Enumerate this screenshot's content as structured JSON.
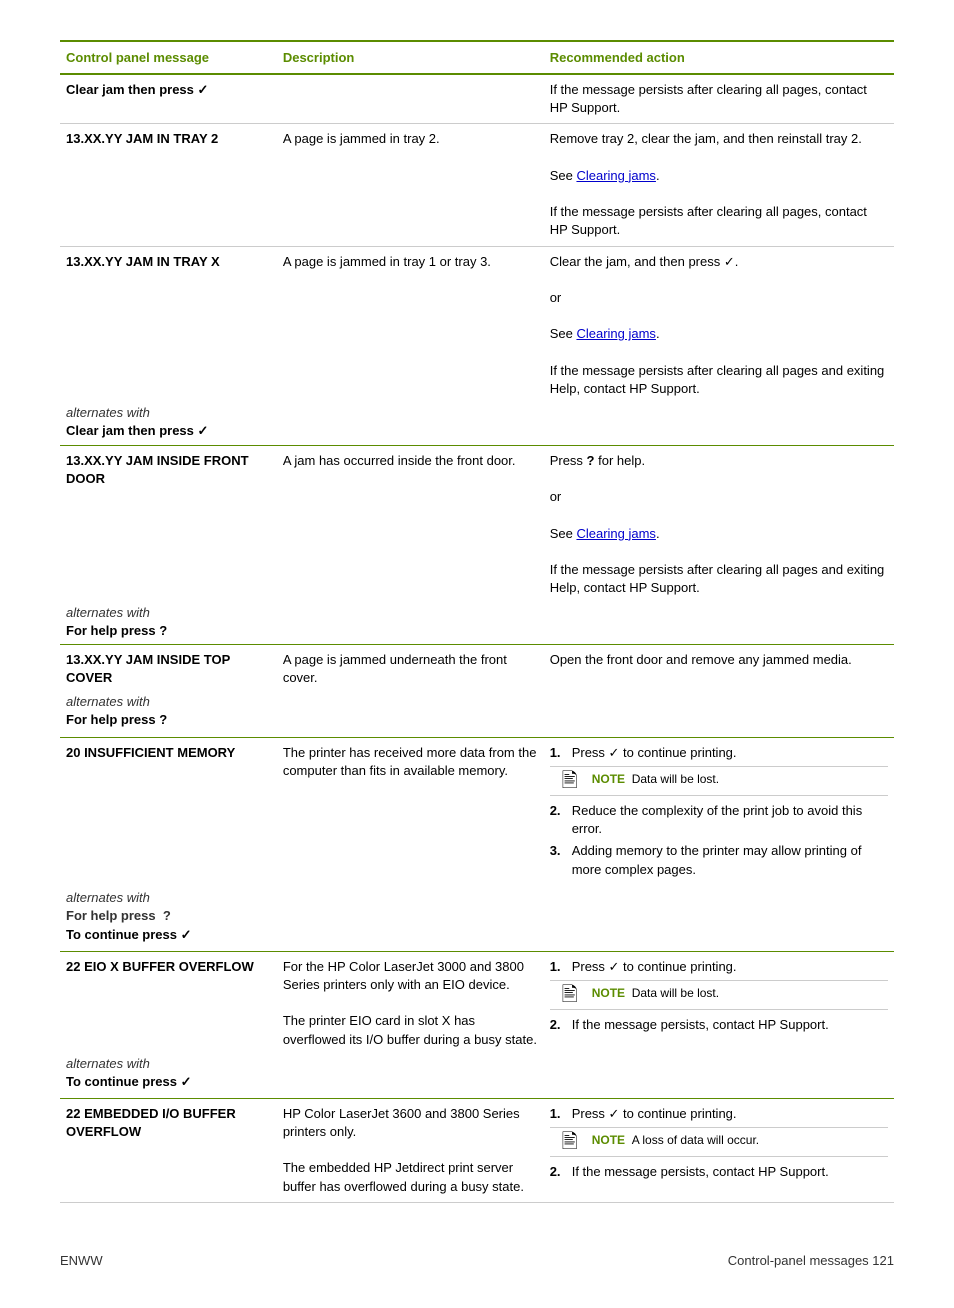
{
  "header": {
    "col1": "Control panel message",
    "col2": "Description",
    "col3": "Recommended action"
  },
  "rows": [
    {
      "id": "row1",
      "message": "Clear jam then press ✓",
      "description": "",
      "action_text": "If the message persists after clearing all pages, contact HP Support.",
      "action_type": "simple"
    },
    {
      "id": "row2",
      "message": "13.XX.YY JAM IN TRAY 2",
      "description": "A page is jammed in tray 2.",
      "action_type": "list_simple",
      "action_items": [
        "Remove tray 2, clear the jam, and then reinstall tray 2.",
        "See [Clearing jams].",
        "If the message persists after clearing all pages, contact HP Support."
      ],
      "action_link_index": 1,
      "action_link_text": "Clearing jams"
    },
    {
      "id": "row3",
      "message": "13.XX.YY JAM IN TRAY X",
      "alternates_with": true,
      "alt_message": "Clear jam then press ✓",
      "description": "A page is jammed in tray 1 or tray 3.",
      "action_type": "list_with_link",
      "action_items": [
        "Clear the jam, and then press ✓.",
        "or",
        "See [Clearing jams].",
        "If the message persists after clearing all pages and exiting Help, contact HP Support."
      ],
      "action_link_index": 2,
      "action_link_text": "Clearing jams"
    },
    {
      "id": "row4",
      "message": "13.XX.YY JAM INSIDE FRONT DOOR",
      "alternates_with": true,
      "alt_message": "For help press ?",
      "description": "A jam has occurred inside the front door.",
      "action_type": "list_with_links",
      "action_items": [
        "Press ? for help.",
        "or",
        "See [Clearing jams].",
        "If the message persists after clearing all pages and exiting Help, contact HP Support."
      ],
      "action_link_index": 2,
      "action_link_text": "Clearing jams"
    },
    {
      "id": "row5",
      "message": "13.XX.YY JAM INSIDE TOP COVER",
      "alternates_with": true,
      "alt_message": "For help press ?",
      "description": "A page is jammed underneath the front cover.",
      "action_type": "simple",
      "action_text": "Open the front door and remove any jammed media."
    },
    {
      "id": "row6",
      "message": "20 INSUFFICIENT MEMORY",
      "alternates_with": true,
      "alt_message2": "For help press  ?",
      "alt_message3": "To continue press ✓",
      "description": "The printer has received more data from the computer than fits in available memory.",
      "action_type": "numbered_with_notes",
      "action_items": [
        {
          "text": "Press ✓ to continue printing.",
          "note": "Data will be lost."
        },
        {
          "text": "Reduce the complexity of the print job to avoid this error.",
          "note": null
        },
        {
          "text": "Adding memory to the printer may allow printing of more complex pages.",
          "note": null
        }
      ]
    },
    {
      "id": "row7",
      "message": "22 EIO X BUFFER OVERFLOW",
      "alternates_with": true,
      "alt_message": "To continue press ✓",
      "description_lines": [
        "For the HP Color LaserJet 3000 and 3800 Series printers only with an EIO device.",
        "The printer EIO card in slot X has overflowed its I/O buffer during a busy state."
      ],
      "action_type": "numbered_with_notes2",
      "action_items": [
        {
          "text": "Press ✓ to continue printing.",
          "note": "Data will be lost."
        },
        {
          "text": "If the message persists, contact HP Support.",
          "note": null
        }
      ]
    },
    {
      "id": "row8",
      "message": "22 EMBEDDED I/O BUFFER OVERFLOW",
      "description_lines": [
        "HP Color LaserJet 3600 and 3800 Series printers only.",
        "The embedded HP Jetdirect print server buffer has overflowed during a busy state."
      ],
      "action_type": "numbered_with_notes3",
      "action_items": [
        {
          "text": "Press ✓ to continue printing.",
          "note": "A loss of data will occur."
        },
        {
          "text": "If the message persists, contact HP Support.",
          "note": null
        }
      ]
    }
  ],
  "footer": {
    "left": "ENWW",
    "right": "Control-panel messages    121"
  },
  "labels": {
    "note": "NOTE",
    "clearing_jams_link": "Clearing jams",
    "alternates_with": "alternates with",
    "or": "or",
    "see_prefix": "See ",
    "see_suffix": "."
  }
}
